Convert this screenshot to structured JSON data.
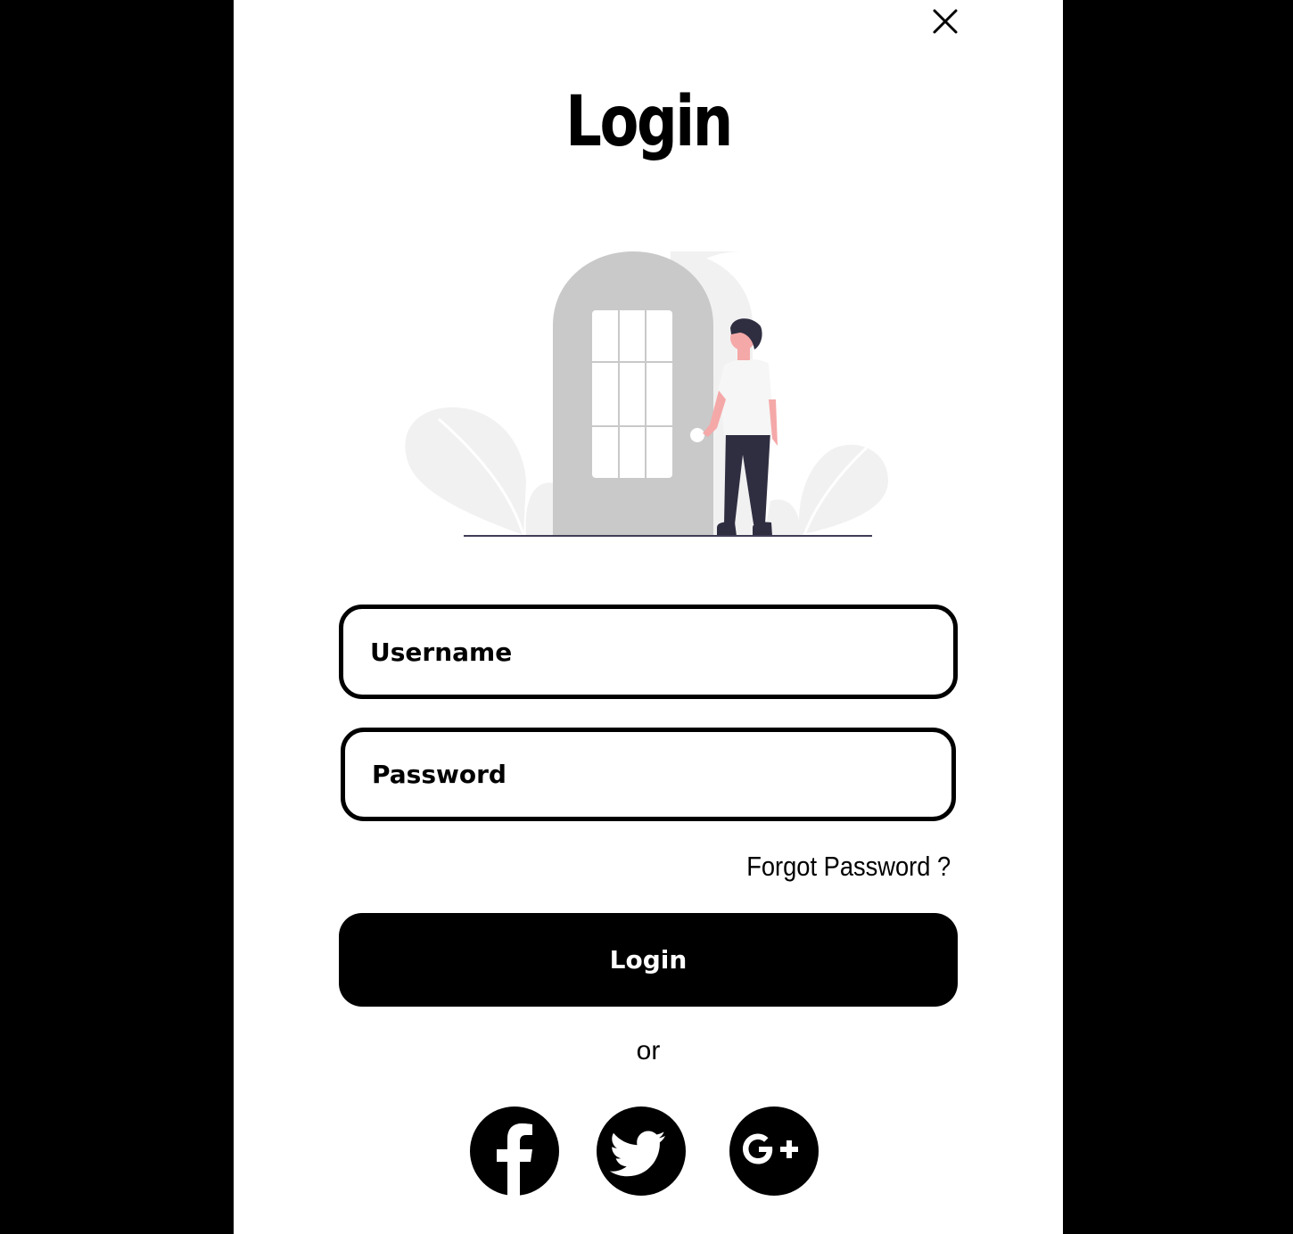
{
  "dialog": {
    "title": "Login",
    "close_icon": "close-icon"
  },
  "form": {
    "username_placeholder": "Username",
    "password_placeholder": "Password",
    "forgot_label": "Forgot Password ?",
    "login_label": "Login",
    "or_label": "or"
  },
  "social": [
    {
      "icon": "facebook-icon"
    },
    {
      "icon": "twitter-icon"
    },
    {
      "icon": "google-plus-icon"
    }
  ],
  "colors": {
    "background": "#000000",
    "panel": "#ffffff",
    "accent": "#000000",
    "illustration_gray": "#c9c9c9",
    "illustration_light": "#f1f1f1",
    "skin": "#f5a8a8",
    "pants": "#2f2e41"
  }
}
